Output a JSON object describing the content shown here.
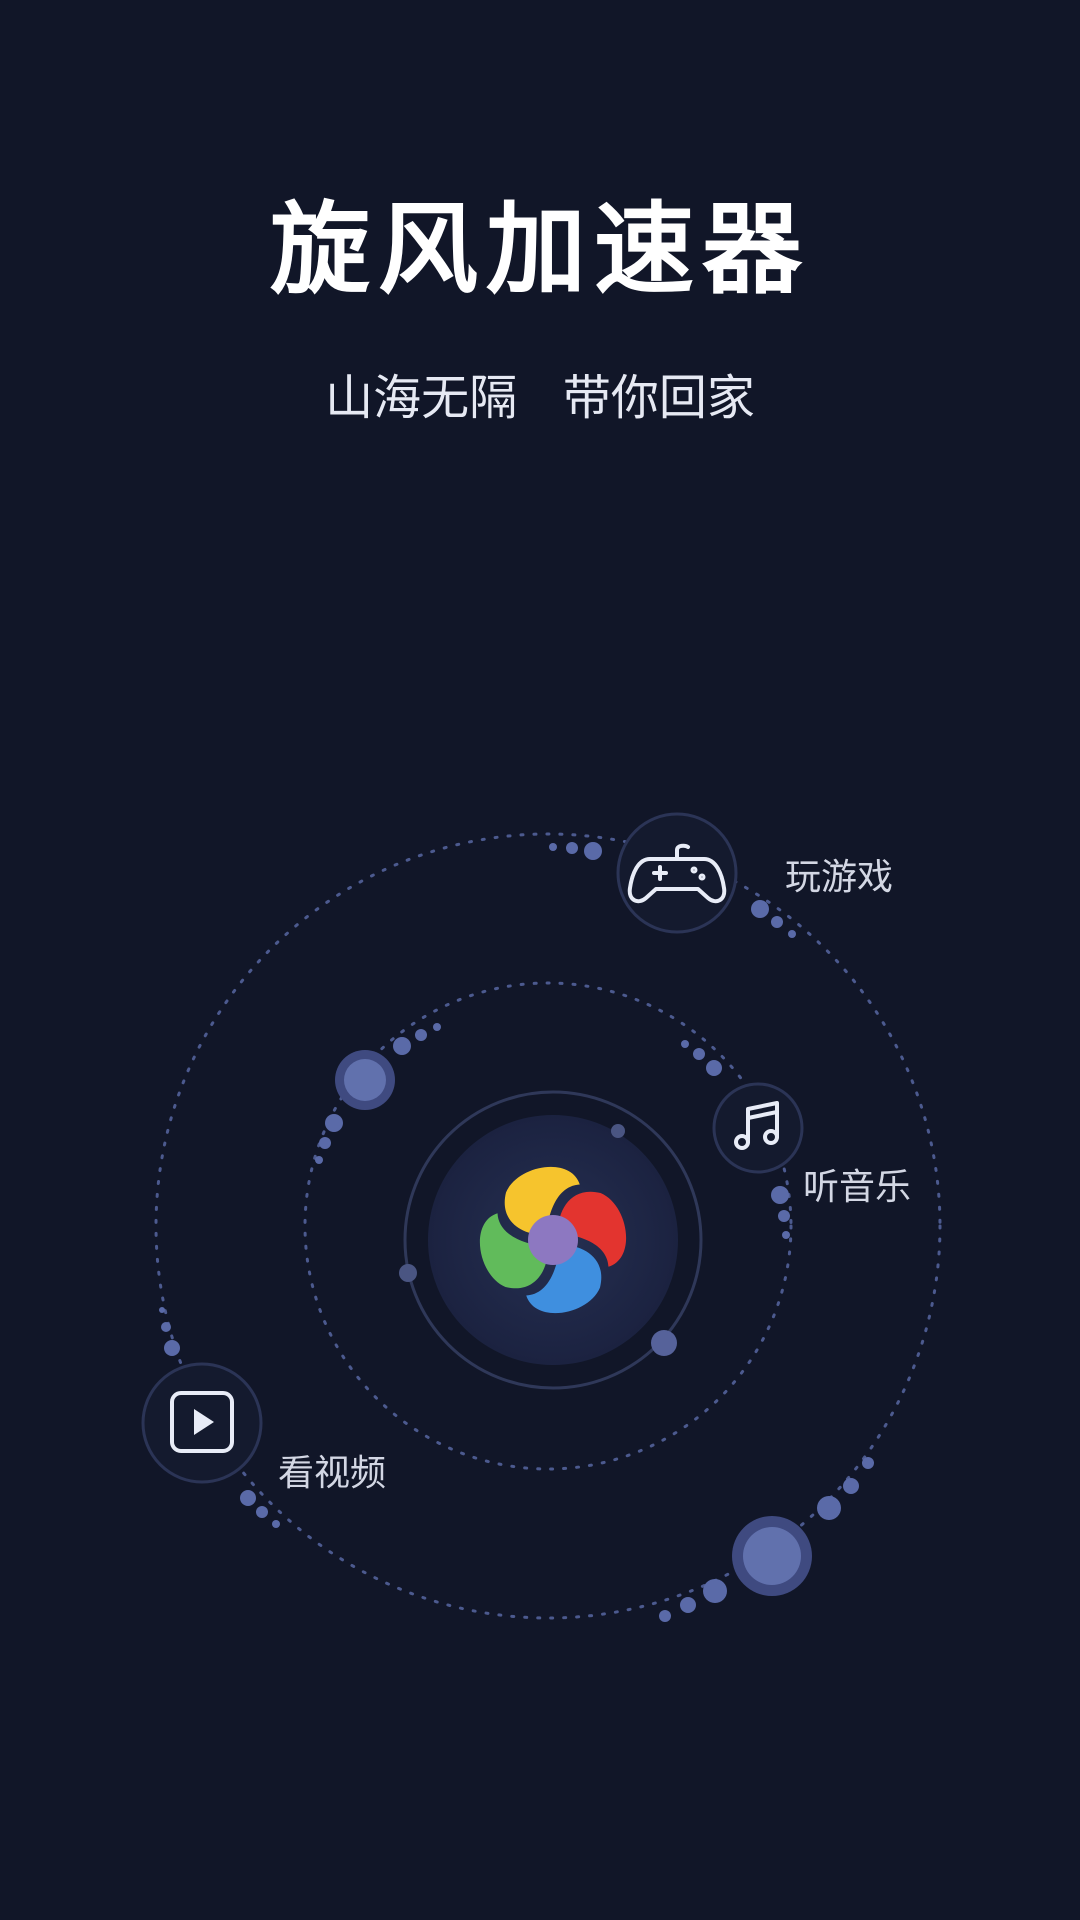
{
  "header": {
    "title": "旋风加速器",
    "slogan": "山海无隔   带你回家"
  },
  "features": [
    {
      "label": "玩游戏",
      "icon": "gamepad-icon"
    },
    {
      "label": "听音乐",
      "icon": "music-note-icon"
    },
    {
      "label": "看视频",
      "icon": "play-video-icon"
    }
  ],
  "logo": {
    "icon": "pinwheel-logo-icon",
    "colors": {
      "yellow": "#f6c42d",
      "red": "#e3342f",
      "blue": "#3f8fdf",
      "green": "#61bb5b",
      "center": "#8d78c1"
    }
  },
  "theme": {
    "background": "#111628",
    "orbit_dot": "#5a6aa8",
    "icon_stroke": "#e8ecf7"
  }
}
